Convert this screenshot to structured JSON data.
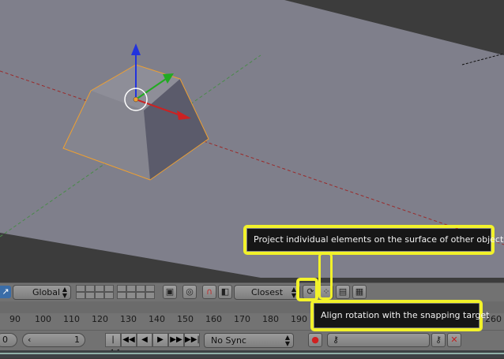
{
  "header": {
    "orientation": "Global",
    "snap_target": "Closest"
  },
  "timeline": {
    "ticks": [
      "90",
      "100",
      "110",
      "120",
      "130",
      "140",
      "150",
      "160",
      "170",
      "180",
      "190",
      "260"
    ],
    "start_field": "0",
    "current_frame": "1",
    "sync_mode": "No Sync"
  },
  "tooltips": {
    "project": "Project individual elements on the surface of other objects",
    "align": "Align rotation with the snapping target"
  },
  "colors": {
    "highlight": "#f2f22a",
    "selection_outline": "#f0a030",
    "x_axis": "#cc2222",
    "y_axis": "#22aa22",
    "z_axis": "#2233dd"
  }
}
